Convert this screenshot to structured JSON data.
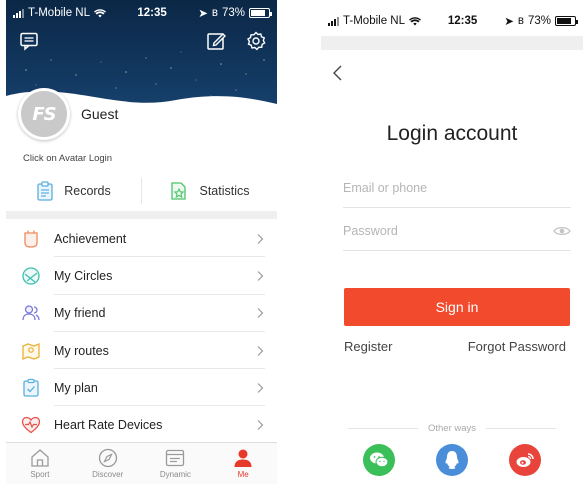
{
  "colors": {
    "accent": "#f24a2c",
    "tab_active": "#e63a2a",
    "hero_bg": "#133a63",
    "wechat": "#3bbf58",
    "qq": "#4a8ed9",
    "weibo": "#e8443c"
  },
  "left": {
    "status": {
      "carrier": "T-Mobile NL",
      "time": "12:35",
      "battery": "73%",
      "battery_level": 0.73
    },
    "header_icons": [
      "message-icon",
      "edit-icon",
      "settings-icon"
    ],
    "avatar_text": "FS",
    "user_name": "Guest",
    "login_hint": "Click on Avatar Login",
    "quick": {
      "records": "Records",
      "statistics": "Statistics"
    },
    "menu": [
      {
        "label": "Achievement",
        "icon": "achievement-icon"
      },
      {
        "label": "My Circles",
        "icon": "circles-icon"
      },
      {
        "label": "My friend",
        "icon": "friend-icon"
      },
      {
        "label": "My routes",
        "icon": "routes-icon"
      },
      {
        "label": "My plan",
        "icon": "plan-icon"
      },
      {
        "label": "Heart Rate Devices",
        "icon": "heart-rate-icon"
      }
    ],
    "tabs": [
      {
        "label": "Sport",
        "icon": "sport-icon"
      },
      {
        "label": "Discover",
        "icon": "compass-icon"
      },
      {
        "label": "Dynamic",
        "icon": "dynamic-icon"
      },
      {
        "label": "Me",
        "icon": "person-icon",
        "active": true
      }
    ]
  },
  "right": {
    "status": {
      "carrier": "T-Mobile NL",
      "time": "12:35",
      "battery": "73%",
      "battery_level": 0.73
    },
    "title": "Login account",
    "email_placeholder": "Email or phone",
    "password_placeholder": "Password",
    "sign_in": "Sign in",
    "register": "Register",
    "forgot": "Forgot Password",
    "other_ways": "Other ways",
    "socials": [
      "wechat-icon",
      "qq-icon",
      "weibo-icon"
    ]
  }
}
